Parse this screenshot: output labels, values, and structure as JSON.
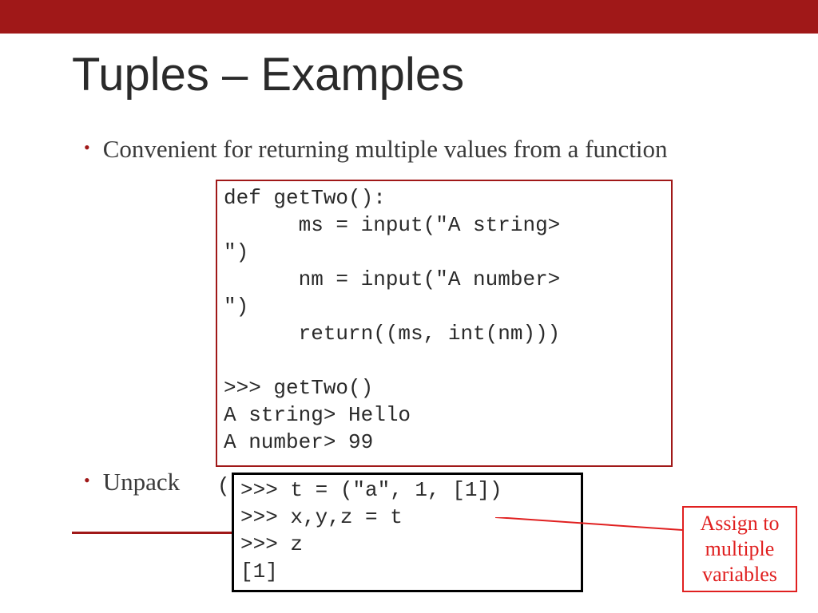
{
  "title": "Tuples – Examples",
  "bullets": {
    "b1": "Convenient for returning multiple values from a function",
    "b2": "Unpack"
  },
  "code": {
    "box1": "def getTwo():\n      ms = input(\"A string> \n\")\n      nm = input(\"A number> \n\")\n      return((ms, int(nm)))\n\n>>> getTwo()\nA string> Hello\nA number> 99",
    "paren": "(",
    "box2": ">>> t = (\"a\", 1, [1])\n>>> x,y,z = t\n>>> z\n[1]"
  },
  "callout": {
    "line1": "Assign to",
    "line2": "multiple",
    "line3": "variables"
  }
}
